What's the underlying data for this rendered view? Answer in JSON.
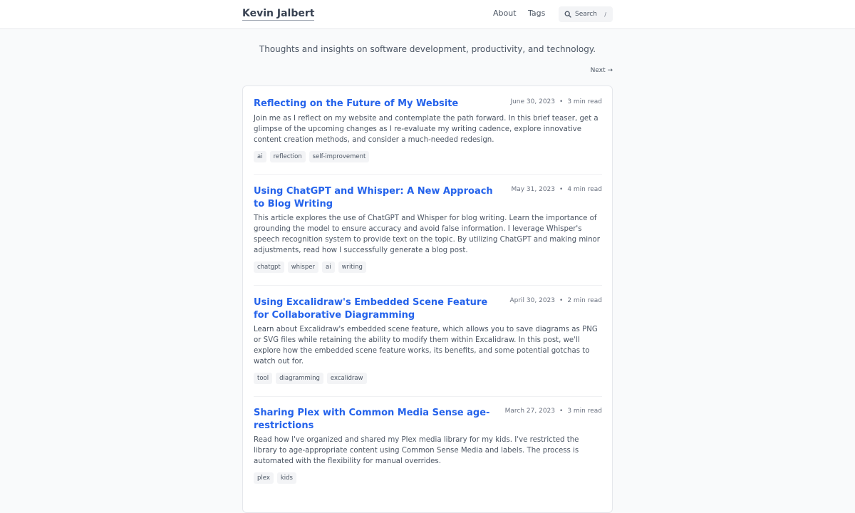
{
  "header": {
    "site_title": "Kevin Jalbert",
    "nav": {
      "about": "About",
      "tags": "Tags"
    },
    "search": {
      "label": "Search",
      "shortcut": "/"
    }
  },
  "tagline": "Thoughts and insights on software development, productivity, and technology.",
  "pagination": {
    "next": "Next →"
  },
  "meta_separator": "•",
  "posts": [
    {
      "title": "Reflecting on the Future of My Website",
      "date": "June 30, 2023",
      "read_time": "3 min read",
      "description": "Join me as I reflect on my website and contemplate the path forward. In this brief teaser, get a glimpse of the upcoming changes as I re-evaluate my writing cadence, explore innovative content creation methods, and consider a much-needed redesign.",
      "tags": [
        "ai",
        "reflection",
        "self-improvement"
      ]
    },
    {
      "title": "Using ChatGPT and Whisper: A New Approach to Blog Writing",
      "date": "May 31, 2023",
      "read_time": "4 min read",
      "description": "This article explores the use of ChatGPT and Whisper for blog writing. Learn the importance of grounding the model to ensure accuracy and avoid false information. I leverage Whisper's speech recognition system to provide text on the topic. By utilizing ChatGPT and making minor adjustments, read how I successfully generate a blog post.",
      "tags": [
        "chatgpt",
        "whisper",
        "ai",
        "writing"
      ]
    },
    {
      "title": "Using Excalidraw's Embedded Scene Feature for Collaborative Diagramming",
      "date": "April 30, 2023",
      "read_time": "2 min read",
      "description": "Learn about Excalidraw's embedded scene feature, which allows you to save diagrams as PNG or SVG files while retaining the ability to modify them within Excalidraw. In this post, we'll explore how the embedded scene feature works, its benefits, and some potential gotchas to watch out for.",
      "tags": [
        "tool",
        "diagramming",
        "excalidraw"
      ]
    },
    {
      "title": "Sharing Plex with Common Media Sense age-restrictions",
      "date": "March 27, 2023",
      "read_time": "3 min read",
      "description": "Read how I've organized and shared my Plex media library for my kids. I've restricted the library to age-appropriate content using Common Sense Media and labels. The process is automated with the flexibility for manual overrides.",
      "tags": [
        "plex",
        "kids"
      ]
    }
  ]
}
